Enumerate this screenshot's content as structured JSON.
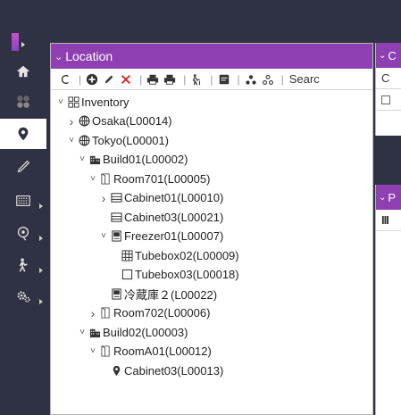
{
  "panel": {
    "title": "Location",
    "toolbar_search": "Searc"
  },
  "tree": [
    {
      "label": "Inventory",
      "icon": "grid-icon",
      "toggle": "down",
      "indent": 0
    },
    {
      "label": "Osaka(L00014)",
      "icon": "globe-icon",
      "toggle": "right",
      "indent": 1
    },
    {
      "label": "Tokyo(L00001)",
      "icon": "globe-icon",
      "toggle": "down",
      "indent": 1
    },
    {
      "label": "Build01(L00002)",
      "icon": "building-icon",
      "toggle": "down",
      "indent": 2
    },
    {
      "label": "Room701(L00005)",
      "icon": "door-icon",
      "toggle": "down",
      "indent": 3
    },
    {
      "label": "Cabinet01(L00010)",
      "icon": "cabinet-icon",
      "toggle": "right",
      "indent": 4
    },
    {
      "label": "Cabinet03(L00021)",
      "icon": "cabinet-icon",
      "toggle": "",
      "indent": 4
    },
    {
      "label": "Freezer01(L00007)",
      "icon": "freezer-icon",
      "toggle": "down",
      "indent": 4
    },
    {
      "label": "Tubebox02(L00009)",
      "icon": "tubebox-grid-icon",
      "toggle": "",
      "indent": 5
    },
    {
      "label": "Tubebox03(L00018)",
      "icon": "tubebox-empty-icon",
      "toggle": "",
      "indent": 5
    },
    {
      "label": "冷蔵庫２(L00022)",
      "icon": "freezer-icon",
      "toggle": "",
      "indent": 4
    },
    {
      "label": "Room702(L00006)",
      "icon": "door-icon",
      "toggle": "right",
      "indent": 3
    },
    {
      "label": "Build02(L00003)",
      "icon": "building-icon",
      "toggle": "down",
      "indent": 2
    },
    {
      "label": "RoomA01(L00012)",
      "icon": "door-icon",
      "toggle": "down",
      "indent": 3
    },
    {
      "label": "Cabinet03(L00013)",
      "icon": "pin-icon",
      "toggle": "",
      "indent": 4
    }
  ],
  "right_panels": [
    {
      "title": "C",
      "row": "C"
    },
    {
      "title": "P",
      "row": "III"
    }
  ],
  "rail_icons": [
    "home-icon",
    "apps-icon",
    "location-pin-icon",
    "pipette-icon",
    "plate-icon",
    "target-icon",
    "person-icon",
    "gears-icon"
  ],
  "colors": {
    "header": "#8e3fb2",
    "rail": "#2f3242"
  }
}
